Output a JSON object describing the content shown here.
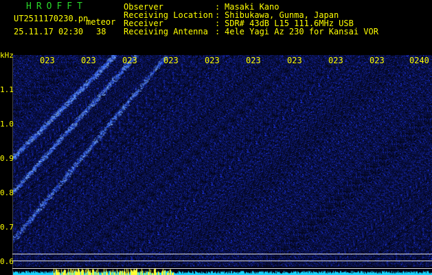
{
  "app": {
    "title": "HROFFT"
  },
  "file": {
    "name": "UT2511170230.pn",
    "tag": "meteor",
    "timestamp": "25.11.17 02:30",
    "count": "38"
  },
  "info": [
    {
      "label": "Observer",
      "value": "Masaki Kano"
    },
    {
      "label": "Receiving Location",
      "value": "Shibukawa, Gunma, Japan"
    },
    {
      "label": "Receiver",
      "value": "SDR# 43dB L15 111.6MHz USB"
    },
    {
      "label": "Receiving Antenna",
      "value": "4ele Yagi Az 230 for Kansai VOR"
    }
  ],
  "y_axis": {
    "unit": "kHz",
    "ticks": [
      "1.1",
      "1.0",
      "0.9",
      "0.8",
      "0.7",
      "0.6"
    ]
  },
  "x_axis": {
    "ticks": [
      "023",
      "023",
      "023",
      "023",
      "023",
      "023",
      "023",
      "023",
      "023",
      "0240"
    ]
  },
  "colors": {
    "text": "#ffff00",
    "title": "#29d829",
    "background": "#000000",
    "noise": "#0a1c7a",
    "trace": "#2f7bff",
    "baseline": "#19d4ff",
    "baseline_peak": "#ffff33"
  }
}
